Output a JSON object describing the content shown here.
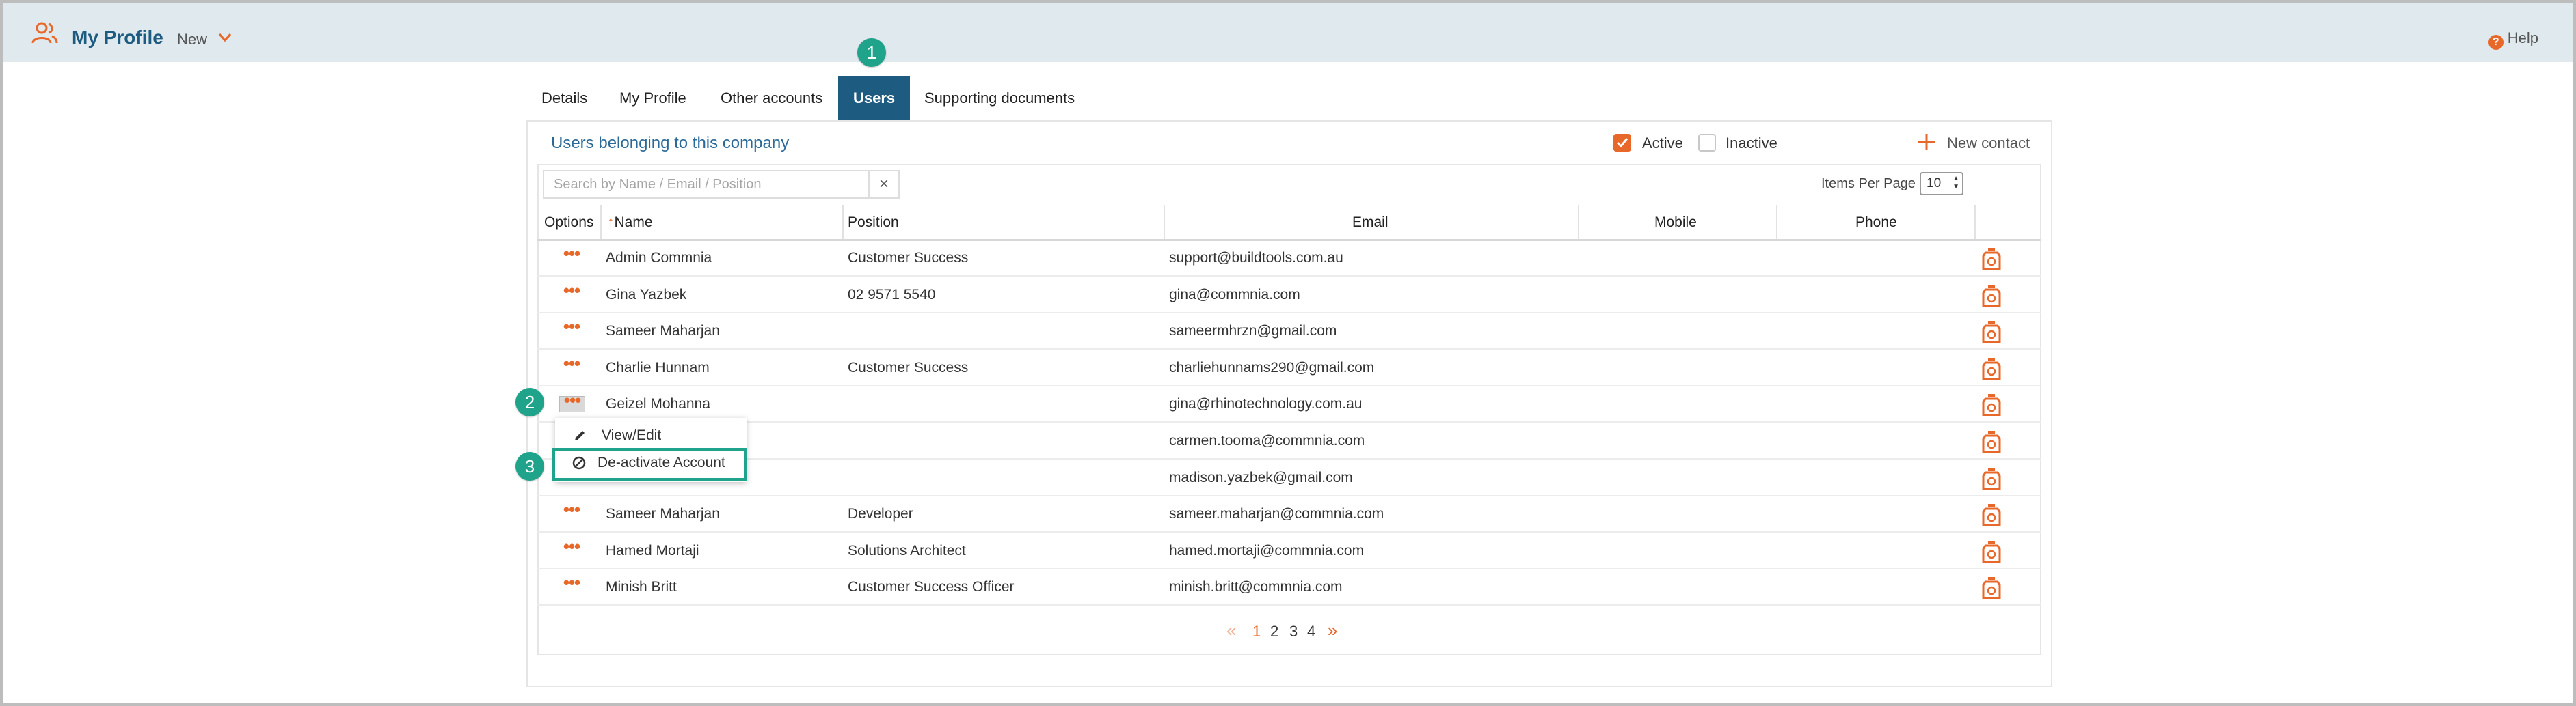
{
  "header": {
    "title": "My Profile",
    "new_label": "New",
    "help_label": "Help"
  },
  "tabs": [
    {
      "label": "Details"
    },
    {
      "label": "My Profile"
    },
    {
      "label": "Other accounts"
    },
    {
      "label": "Users"
    },
    {
      "label": "Supporting documents"
    }
  ],
  "active_tab": "Users",
  "badges": [
    "1",
    "2",
    "3"
  ],
  "panel": {
    "title": "Users belonging to this company",
    "filters": {
      "active_label": "Active",
      "active_checked": true,
      "inactive_label": "Inactive",
      "inactive_checked": false
    },
    "new_contact_label": "New contact"
  },
  "search": {
    "placeholder": "Search by Name / Email / Position",
    "clear": "×"
  },
  "items_per_page": {
    "label": "Items Per Page",
    "value": "10"
  },
  "table": {
    "headers": {
      "options": "Options",
      "sort_arrow": "↑",
      "name": "Name",
      "position": "Position",
      "email": "Email",
      "mobile": "Mobile",
      "phone": "Phone"
    },
    "rows": [
      {
        "name": "Admin Commnia",
        "position": "Customer Success",
        "email": "support@buildtools.com.au"
      },
      {
        "name": "Gina Yazbek",
        "position": "02 9571 5540",
        "email": "gina@commnia.com"
      },
      {
        "name": "Sameer Maharjan",
        "position": "",
        "email": "sameermhrzn@gmail.com"
      },
      {
        "name": "Charlie Hunnam",
        "position": "Customer Success",
        "email": "charliehunnams290@gmail.com"
      },
      {
        "name": "Geizel Mohanna",
        "position": "",
        "email": "gina@rhinotechnology.com.au"
      },
      {
        "name": "",
        "position": "",
        "email": "carmen.tooma@commnia.com"
      },
      {
        "name": "",
        "position": "",
        "email": "madison.yazbek@gmail.com"
      },
      {
        "name": "Sameer Maharjan",
        "position": "Developer",
        "email": "sameer.maharjan@commnia.com"
      },
      {
        "name": "Hamed Mortaji",
        "position": "Solutions Architect",
        "email": "hamed.mortaji@commnia.com"
      },
      {
        "name": "Minish Britt",
        "position": "Customer Success Officer",
        "email": "minish.britt@commnia.com"
      }
    ],
    "options_glyph": "•••"
  },
  "context_menu": {
    "items": [
      {
        "label": "View/Edit",
        "icon": "pencil-icon"
      },
      {
        "label": "De-activate Account",
        "icon": "block-icon"
      }
    ]
  },
  "pagination": {
    "prev": "«",
    "pages": [
      "1",
      "2",
      "3",
      "4"
    ],
    "current": "1",
    "next": "»"
  },
  "colors": {
    "header_bg": "#dfe9ee",
    "primary": "#1d5b80",
    "accent": "#e8682a",
    "badge": "#1fa38a"
  }
}
